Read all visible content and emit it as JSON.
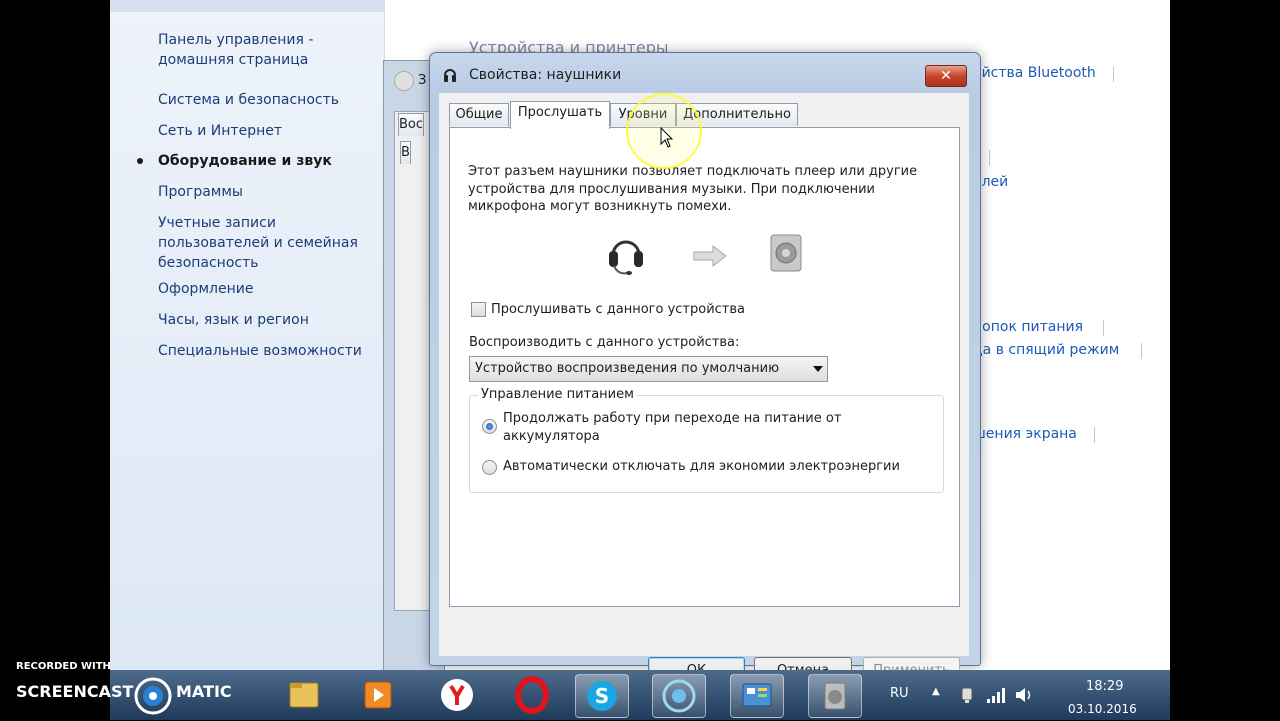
{
  "control_panel": {
    "nav": [
      {
        "label": "Панель управления -\nдомашняя страница",
        "active": false
      },
      {
        "label": "Система и безопасность",
        "active": false
      },
      {
        "label": "Сеть и Интернет",
        "active": false
      },
      {
        "label": "Оборудование и звук",
        "active": true
      },
      {
        "label": "Программы",
        "active": false
      },
      {
        "label": "Учетные записи\nпользователей и семейная\nбезопасность",
        "active": false
      },
      {
        "label": "Оформление",
        "active": false
      },
      {
        "label": "Часы, язык и регион",
        "active": false
      },
      {
        "label": "Специальные возможности",
        "active": false
      }
    ],
    "heading_partial": "Устройства и принтеры",
    "right_links": [
      "ойства Bluetooth",
      "елей",
      "нопок питания",
      "да в спящий режим",
      "шения экрана"
    ]
  },
  "back_window": {
    "title_partial": "З",
    "tab_partial": "Вос",
    "text_partial": "В"
  },
  "dialog": {
    "title": "Свойства: наушники",
    "close_glyph": "✕",
    "tabs": [
      {
        "label": "Общие",
        "active": false
      },
      {
        "label": "Прослушать",
        "active": true
      },
      {
        "label": "Уровни",
        "active": false
      },
      {
        "label": "Дополнительно",
        "active": false
      }
    ],
    "description": "Этот разъем наушники позволяет подключать плеер или другие устройства для прослушивания музыки. При подключении микрофона могут возникнуть помехи.",
    "listen_checkbox": {
      "label": "Прослушивать с данного устройства",
      "checked": false
    },
    "playback_label": "Воспроизводить с данного устройства:",
    "playback_select": "Устройство воспроизведения по умолчанию",
    "power": {
      "legend": "Управление питанием",
      "options": [
        {
          "label": "Продолжать работу при переходе на питание от\nаккумулятора",
          "selected": true
        },
        {
          "label": "Автоматически отключать для экономии электроэнергии",
          "selected": false
        }
      ]
    },
    "buttons": {
      "ok": "ОК",
      "cancel": "Отмена",
      "apply": "Применить"
    }
  },
  "taskbar": {
    "apps": [
      "file-manager-icon",
      "media-player-icon",
      "yandex-browser-icon",
      "opera-icon",
      "skype-icon",
      "circle-app-icon",
      "control-panel-icon",
      "sound-icon"
    ],
    "language": "RU",
    "time": "18:29",
    "date": "03.10.2016"
  },
  "watermark": {
    "line1": "RECORDED WITH",
    "brand_left": "SCREENCAST",
    "brand_right": "MATIC"
  }
}
